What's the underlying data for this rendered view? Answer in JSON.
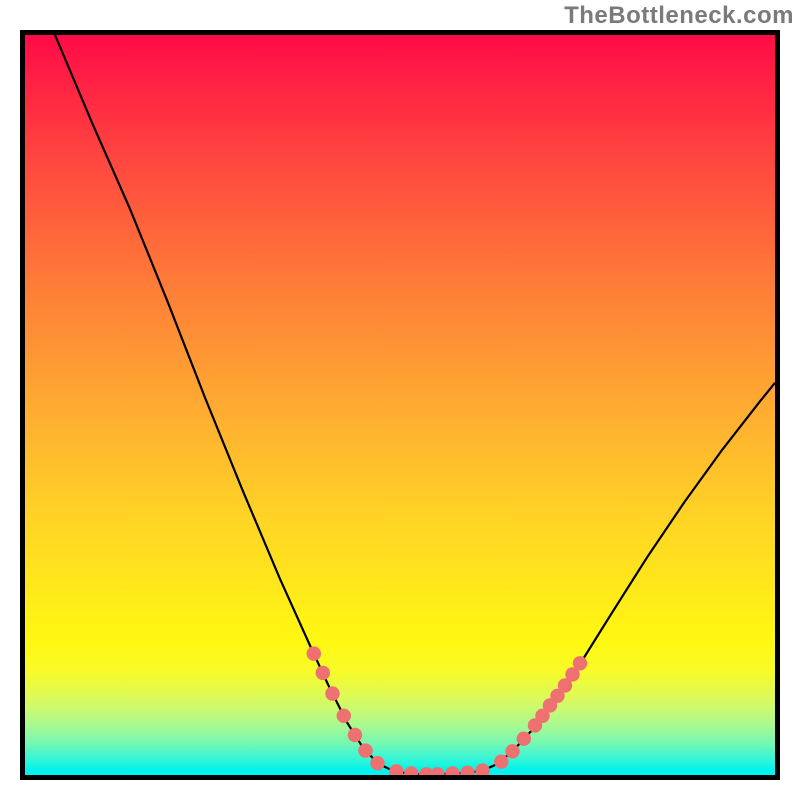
{
  "watermark": "TheBottleneck.com",
  "chart_data": {
    "type": "line",
    "title": "",
    "xlabel": "",
    "ylabel": "",
    "xlim": [
      0,
      100
    ],
    "ylim": [
      0,
      100
    ],
    "gradient_stops": [
      {
        "pos": 0,
        "color": "#ff0b47"
      },
      {
        "pos": 6,
        "color": "#ff2044"
      },
      {
        "pos": 18,
        "color": "#ff4a3f"
      },
      {
        "pos": 33,
        "color": "#ff7a38"
      },
      {
        "pos": 52,
        "color": "#ffb030"
      },
      {
        "pos": 65,
        "color": "#ffd325"
      },
      {
        "pos": 75,
        "color": "#ffe91a"
      },
      {
        "pos": 82,
        "color": "#fff812"
      },
      {
        "pos": 86,
        "color": "#f8fb29"
      },
      {
        "pos": 90,
        "color": "#d7fa60"
      },
      {
        "pos": 93,
        "color": "#aef98d"
      },
      {
        "pos": 95.5,
        "color": "#7af8b0"
      },
      {
        "pos": 97.2,
        "color": "#48f6cd"
      },
      {
        "pos": 98.5,
        "color": "#1ff5df"
      },
      {
        "pos": 99.3,
        "color": "#00f4ec"
      },
      {
        "pos": 100,
        "color": "#00f2f6"
      }
    ],
    "series": [
      {
        "name": "bottleneck-curve",
        "color": "#000000",
        "points": [
          {
            "x": 4.0,
            "y": 100.0
          },
          {
            "x": 9.0,
            "y": 88.0
          },
          {
            "x": 14.0,
            "y": 76.5
          },
          {
            "x": 19.0,
            "y": 64.0
          },
          {
            "x": 24.0,
            "y": 51.0
          },
          {
            "x": 29.0,
            "y": 38.5
          },
          {
            "x": 34.0,
            "y": 26.5
          },
          {
            "x": 38.0,
            "y": 17.5
          },
          {
            "x": 40.5,
            "y": 12.0
          },
          {
            "x": 43.0,
            "y": 7.0
          },
          {
            "x": 45.0,
            "y": 3.8
          },
          {
            "x": 47.0,
            "y": 1.6
          },
          {
            "x": 49.0,
            "y": 0.6
          },
          {
            "x": 51.0,
            "y": 0.2
          },
          {
            "x": 53.0,
            "y": 0.1
          },
          {
            "x": 55.0,
            "y": 0.1
          },
          {
            "x": 57.0,
            "y": 0.2
          },
          {
            "x": 59.0,
            "y": 0.3
          },
          {
            "x": 61.0,
            "y": 0.6
          },
          {
            "x": 63.0,
            "y": 1.5
          },
          {
            "x": 65.0,
            "y": 3.2
          },
          {
            "x": 68.0,
            "y": 6.5
          },
          {
            "x": 71.0,
            "y": 10.5
          },
          {
            "x": 74.0,
            "y": 15.0
          },
          {
            "x": 78.0,
            "y": 21.5
          },
          {
            "x": 83.0,
            "y": 29.5
          },
          {
            "x": 88.0,
            "y": 37.0
          },
          {
            "x": 93.0,
            "y": 44.0
          },
          {
            "x": 98.0,
            "y": 50.5
          },
          {
            "x": 100.0,
            "y": 53.0
          }
        ]
      },
      {
        "name": "highlight-dots",
        "color": "#ef7070",
        "points": [
          {
            "x": 38.5,
            "y": 16.4
          },
          {
            "x": 39.7,
            "y": 13.8
          },
          {
            "x": 41.0,
            "y": 11.0
          },
          {
            "x": 42.5,
            "y": 8.0
          },
          {
            "x": 44.0,
            "y": 5.4
          },
          {
            "x": 45.4,
            "y": 3.3
          },
          {
            "x": 47.0,
            "y": 1.6
          },
          {
            "x": 49.5,
            "y": 0.5
          },
          {
            "x": 51.5,
            "y": 0.2
          },
          {
            "x": 53.5,
            "y": 0.1
          },
          {
            "x": 55.0,
            "y": 0.1
          },
          {
            "x": 57.0,
            "y": 0.2
          },
          {
            "x": 59.0,
            "y": 0.3
          },
          {
            "x": 61.0,
            "y": 0.6
          },
          {
            "x": 63.5,
            "y": 1.8
          },
          {
            "x": 65.0,
            "y": 3.2
          },
          {
            "x": 66.5,
            "y": 4.9
          },
          {
            "x": 68.0,
            "y": 6.7
          },
          {
            "x": 69.0,
            "y": 8.0
          },
          {
            "x": 70.0,
            "y": 9.4
          },
          {
            "x": 71.0,
            "y": 10.7
          },
          {
            "x": 72.0,
            "y": 12.1
          },
          {
            "x": 73.0,
            "y": 13.6
          },
          {
            "x": 74.0,
            "y": 15.1
          }
        ]
      }
    ]
  }
}
